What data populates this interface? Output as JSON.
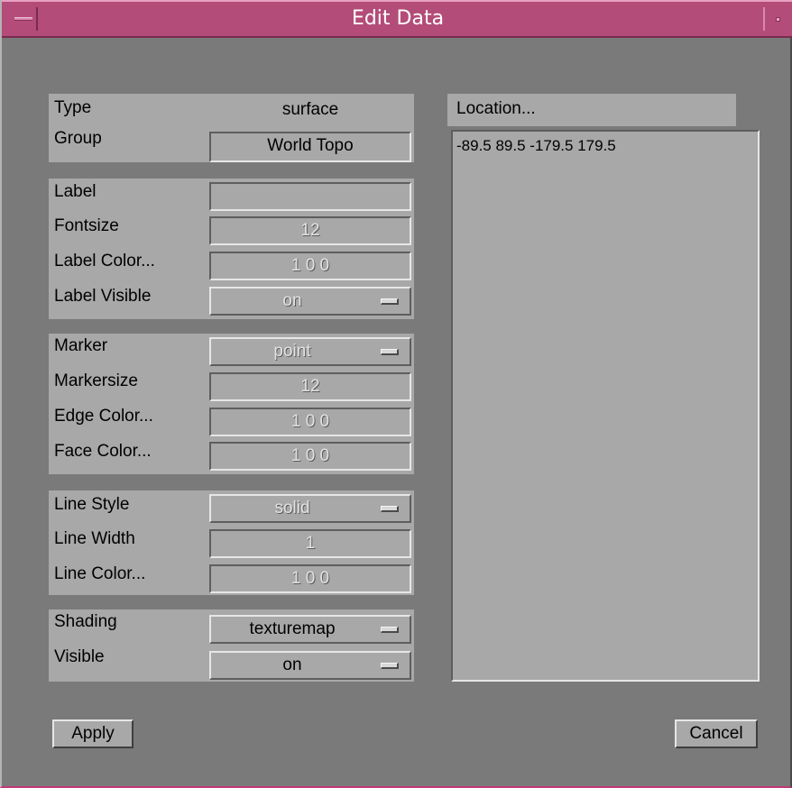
{
  "window": {
    "title": "Edit Data"
  },
  "group1": {
    "type_label": "Type",
    "type_value": "surface",
    "group_label": "Group",
    "group_value": "World Topo"
  },
  "group2": {
    "label_label": "Label",
    "label_value": "",
    "fontsize_label": "Fontsize",
    "fontsize_value": "12",
    "label_color_label": "Label Color...",
    "label_color_value": "1 0 0",
    "label_visible_label": "Label Visible",
    "label_visible_value": "on"
  },
  "group3": {
    "marker_label": "Marker",
    "marker_value": "point",
    "markersize_label": "Markersize",
    "markersize_value": "12",
    "edge_color_label": "Edge Color...",
    "edge_color_value": "1 0 0",
    "face_color_label": "Face Color...",
    "face_color_value": "1 0 0"
  },
  "group4": {
    "line_style_label": "Line Style",
    "line_style_value": "solid",
    "line_width_label": "Line Width",
    "line_width_value": "1",
    "line_color_label": "Line Color...",
    "line_color_value": "1 0 0"
  },
  "group5": {
    "shading_label": "Shading",
    "shading_value": "texturemap",
    "visible_label": "Visible",
    "visible_value": "on"
  },
  "location": {
    "header": "Location...",
    "value": "-89.5 89.5 -179.5 179.5"
  },
  "buttons": {
    "apply": "Apply",
    "cancel": "Cancel"
  },
  "colors": {
    "titlebar": "#b34c78",
    "background": "#7a7a7a",
    "panel": "#a8a8a8"
  },
  "icons": {
    "window_menu": "window-menu-icon",
    "minimize": "minimize-icon",
    "option_indicator": "option-menu-indicator-icon"
  }
}
